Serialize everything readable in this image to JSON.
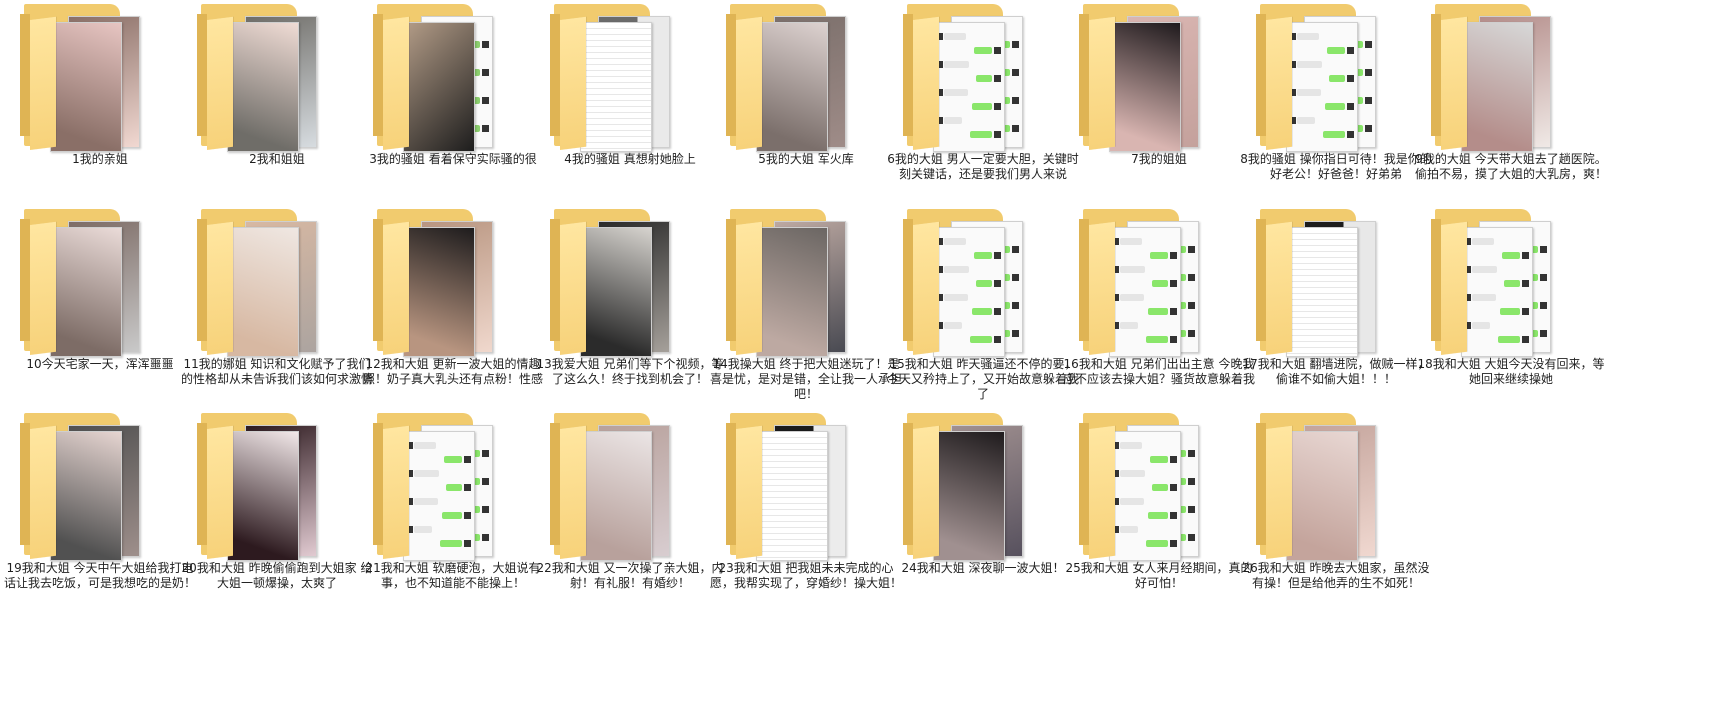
{
  "window": {
    "title": ""
  },
  "folders": [
    {
      "label": "1我的亲姐",
      "thumb": "photo",
      "colors": [
        "#e7c5c2",
        "#8a6f67",
        "#f1d8d1"
      ]
    },
    {
      "label": "2我和姐姐",
      "thumb": "photo",
      "colors": [
        "#f0dcd5",
        "#6f6d68",
        "#d7dce0"
      ]
    },
    {
      "label": "3我的骚姐 看着保守实际骚的很",
      "thumb": "mixed",
      "colors": [
        "#b49d88",
        "#1d1d1d",
        "#8ccf6e"
      ]
    },
    {
      "label": "4我的骚姐 真想射她脸上",
      "thumb": "doc",
      "colors": [
        "#ffffff",
        "#6b6b6b",
        "#eaeaea"
      ]
    },
    {
      "label": "5我的大姐 军火库",
      "thumb": "photo",
      "colors": [
        "#ddd2d0",
        "#7b6f6b",
        "#9f8c88"
      ]
    },
    {
      "label": "6我的大姐 男人一定要大胆，关键时刻关键话，还是要我们男人来说",
      "thumb": "chat",
      "colors": [
        "#fafafa",
        "#8ae66a",
        "#e5e5e5"
      ]
    },
    {
      "label": "7我的姐姐",
      "thumb": "photo",
      "colors": [
        "#1f1a1d",
        "#d9b5b1",
        "#c4a19c"
      ]
    },
    {
      "label": "8我的骚姐 操你指日可待！我是你的好老公！好爸爸！好弟弟",
      "thumb": "chat",
      "colors": [
        "#fafafa",
        "#8ae66a",
        "#e5e5e5"
      ]
    },
    {
      "label": "9我的大姐 今天带大姐去了趟医院。偷拍不易，摸了大姐的大乳房，爽！",
      "thumb": "photo",
      "colors": [
        "#d7d8d8",
        "#b48d8a",
        "#f0e9e6"
      ]
    },
    {
      "label": "10今天宅家一天，浑浑噩噩",
      "thumb": "photo",
      "colors": [
        "#eadbd8",
        "#7d6c66",
        "#c9c9c9"
      ]
    },
    {
      "label": "11我的娜姐 知识和文化赋予了我们的性格却从未告诉我们该如何求激情",
      "thumb": "photo",
      "colors": [
        "#efe7e2",
        "#d7b8a2",
        "#aca4a0"
      ]
    },
    {
      "label": "12我和大姐 更新一波大姐的情趣照！奶子真大乳头还有点粉！性感",
      "thumb": "photo",
      "colors": [
        "#1e1c1d",
        "#b89580",
        "#f0d8cd"
      ]
    },
    {
      "label": "13我爱大姐 兄弟们等下个视频，等了这么久！终于找到机会了！",
      "thumb": "photo",
      "colors": [
        "#d6d3ce",
        "#2b2b2b",
        "#a5a09a"
      ]
    },
    {
      "label": "14我操大姐 终于把大姐迷玩了！是喜是忧，是对是错，全让我一人承担吧！",
      "thumb": "photo",
      "colors": [
        "#6b6663",
        "#bda9a2",
        "#494a52"
      ]
    },
    {
      "label": "15我和大姐 昨天骚逼还不停的要，今天又矜持上了，又开始故意躲着我了",
      "thumb": "chat",
      "colors": [
        "#fafafa",
        "#8ae66a",
        "#e5e5e5"
      ]
    },
    {
      "label": "16我和大姐 兄弟们出出主意 今晚我应不应该去操大姐？骚货故意躲着我",
      "thumb": "chat",
      "colors": [
        "#fafafa",
        "#8ae66a",
        "#e5e5e5"
      ]
    },
    {
      "label": "17我和大姐 翻墙进院，做贼一样，偷谁不如偷大姐！！！",
      "thumb": "doc",
      "colors": [
        "#ffffff",
        "#1d1d1d",
        "#e8e8e8"
      ]
    },
    {
      "label": "18我和大姐 大姐今天没有回来，等她回来继续操她",
      "thumb": "chat",
      "colors": [
        "#fafafa",
        "#8ae66a",
        "#e5e5e5"
      ]
    },
    {
      "label": "19我和大姐 今天中午大姐给我打电话让我去吃饭，可是我想吃的是奶！",
      "thumb": "photo",
      "colors": [
        "#e6d5d1",
        "#515151",
        "#9e8f8b"
      ]
    },
    {
      "label": "20我和大姐 昨晚偷偷跑到大姐家 给大姐一顿爆操，太爽了",
      "thumb": "photo",
      "colors": [
        "#f2e8e9",
        "#2d1a1f",
        "#e1cad1"
      ]
    },
    {
      "label": "21我和大姐 软磨硬泡，大姐说有事，也不知道能不能操上！",
      "thumb": "chat",
      "colors": [
        "#fafafa",
        "#8ae66a",
        "#e5e5e5"
      ]
    },
    {
      "label": "22我和大姐 又一次操了亲大姐，内射！有礼服！有婚纱！",
      "thumb": "photo",
      "colors": [
        "#ebe5e5",
        "#b8a19c",
        "#d8cdd0"
      ]
    },
    {
      "label": "23我和大姐 把我姐未未完成的心愿，我帮实现了，穿婚纱！操大姐！",
      "thumb": "doc",
      "colors": [
        "#ffffff",
        "#1b1b1b",
        "#ececec"
      ]
    },
    {
      "label": "24我和大姐 深夜聊一波大姐！",
      "thumb": "photo",
      "colors": [
        "#1f1b1d",
        "#a09090",
        "#57515e"
      ]
    },
    {
      "label": "25我和大姐 女人来月经期间，真的好可怕！",
      "thumb": "chat",
      "colors": [
        "#fafafa",
        "#8ae66a",
        "#e5e5e5"
      ]
    },
    {
      "label": "26我和大姐 昨晚去大姐家，虽然没有操！但是给他弄的生不如死！",
      "thumb": "photo",
      "colors": [
        "#e8d7d3",
        "#c4a49c",
        "#f0d8d0"
      ]
    }
  ]
}
